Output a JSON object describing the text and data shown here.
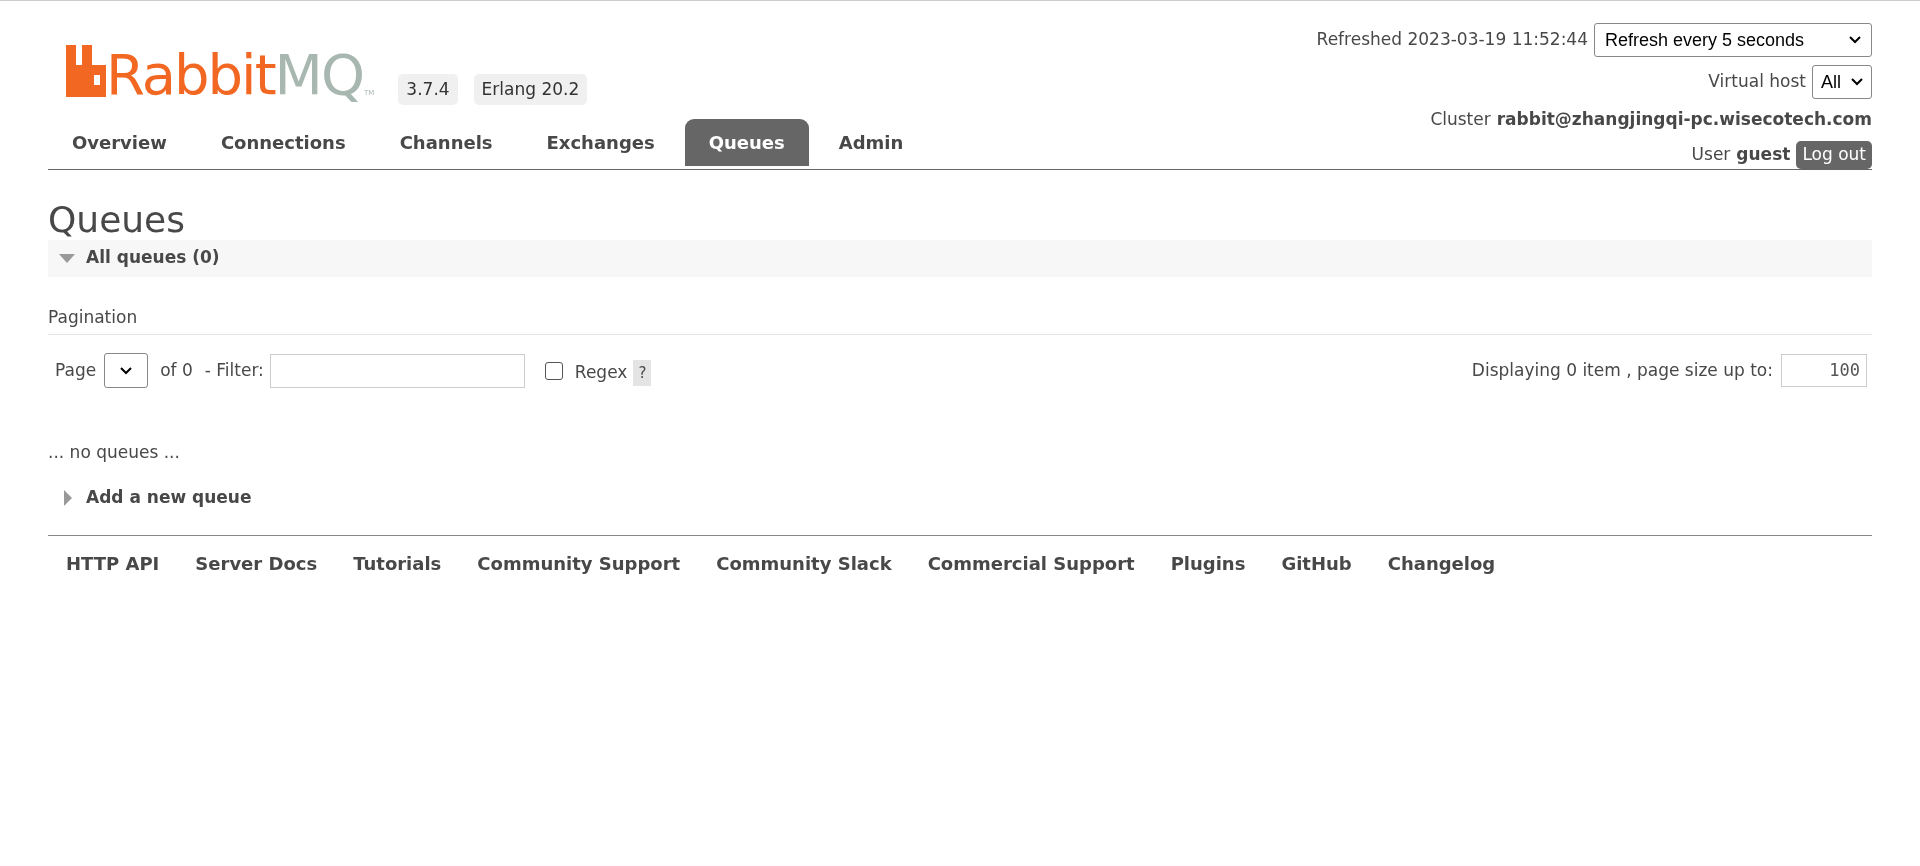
{
  "header": {
    "logo": {
      "part_1": "Rabbit",
      "part_2": "MQ",
      "mark": "TM"
    },
    "badges": [
      "3.7.4",
      "Erlang 20.2"
    ],
    "tabs": [
      {
        "label": "Overview",
        "selected": false
      },
      {
        "label": "Connections",
        "selected": false
      },
      {
        "label": "Channels",
        "selected": false
      },
      {
        "label": "Exchanges",
        "selected": false
      },
      {
        "label": "Queues",
        "selected": true
      },
      {
        "label": "Admin",
        "selected": false
      }
    ],
    "refreshed": {
      "label": "Refreshed 2023-03-19 11:52:44",
      "select": "Refresh every 5 seconds"
    },
    "virtual_host": {
      "label": "Virtual host",
      "select": "All"
    },
    "cluster": {
      "label": "Cluster",
      "value": "rabbit@zhangjingqi-pc.wisecotech.com"
    },
    "user": {
      "label": "User",
      "value": "guest",
      "button": "Log out"
    }
  },
  "page_title": "Queues",
  "sections": [
    {
      "title": "All queues (0)",
      "expanded": true
    },
    {
      "title": "Add a new queue",
      "expanded": false
    }
  ],
  "pagination": {
    "title": "Pagination",
    "page_label": "Page",
    "of_label": "of 0",
    "filter_label": "- Filter:",
    "regex": {
      "label": "Regex",
      "checked": false
    },
    "help": "?",
    "displaying": "Displaying 0 item , page size up to:",
    "page_size": "100"
  },
  "empty_message": "... no queues ...",
  "footer": [
    "HTTP API",
    "Server Docs",
    "Tutorials",
    "Community Support",
    "Community Slack",
    "Commercial Support",
    "Plugins",
    "GitHub",
    "Changelog"
  ]
}
